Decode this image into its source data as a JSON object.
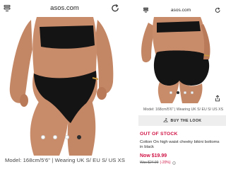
{
  "left": {
    "url": "asos.com",
    "carousel_dots": 4,
    "active_dot": 3,
    "caption": "Model: 168cm/5'6\" | Wearing UK S/ EU S/ US XS"
  },
  "right": {
    "url": "asos.com",
    "carousel_dots": 4,
    "active_dot": 2,
    "caption": "Model: 168cm/5'6\" | Wearing UK S/ EU S/ US XS",
    "buy_the_look_label": "BUY THE LOOK",
    "stock_status": "OUT OF STOCK",
    "product_title": "Cotton On high waist cheeky bikini bottoms in black",
    "price_now": "Now $19.99",
    "price_was": "Was $24.99",
    "discount": "(-20%)"
  },
  "colors": {
    "accent_red": "#d01345",
    "text_dark": "#2d2d2d",
    "button_bg": "#eeeeee",
    "bikini_black": "#141414",
    "skin": "#c98c6b"
  },
  "icons": [
    "tabs-icon",
    "reload-icon",
    "share-icon",
    "hanger-icon",
    "info-icon"
  ]
}
